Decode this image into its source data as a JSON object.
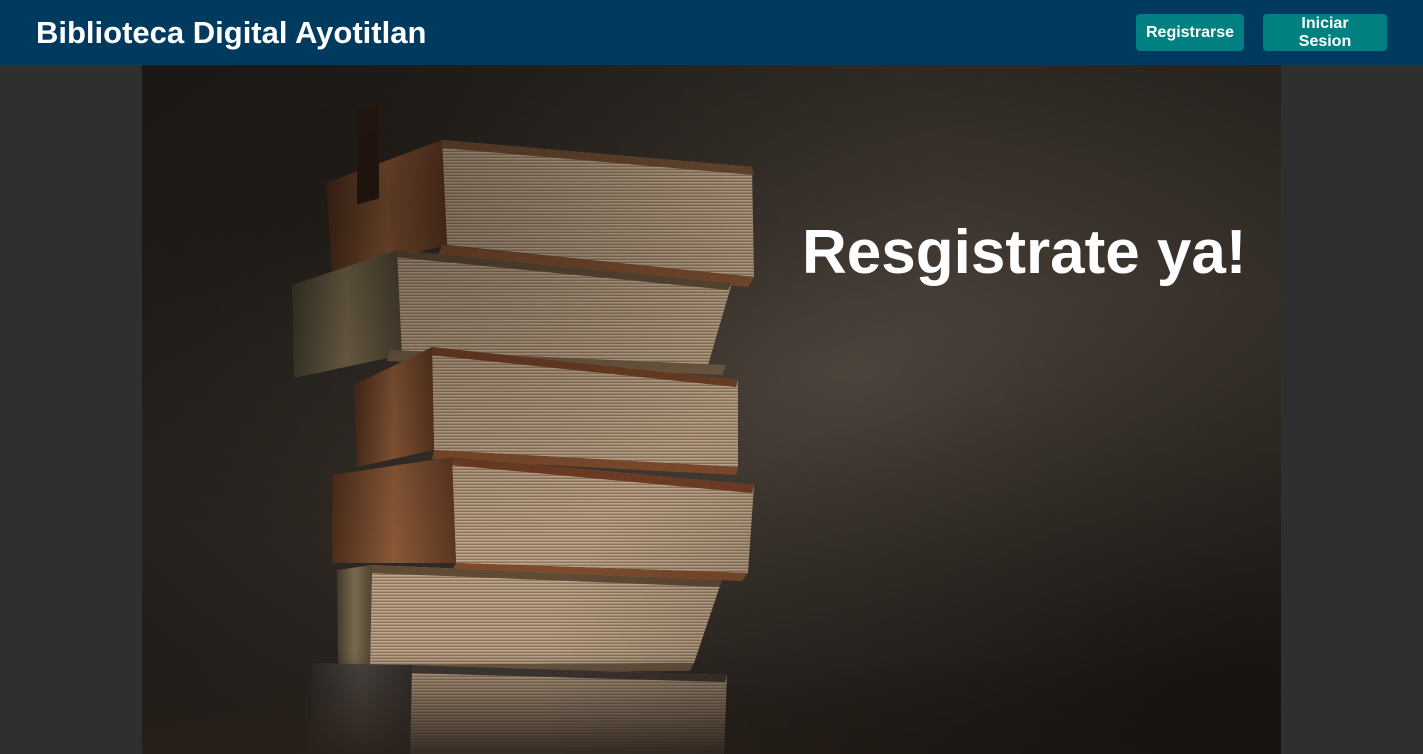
{
  "header": {
    "title": "Biblioteca Digital Ayotitlan",
    "register_label": "Registrarse",
    "login_label": "Iniciar Sesion"
  },
  "hero": {
    "headline": "Resgistrate ya!",
    "image": "stack-of-old-books"
  },
  "colors": {
    "topbar": "#003a5f",
    "button": "#008080",
    "page_background": "#2f2f31"
  }
}
